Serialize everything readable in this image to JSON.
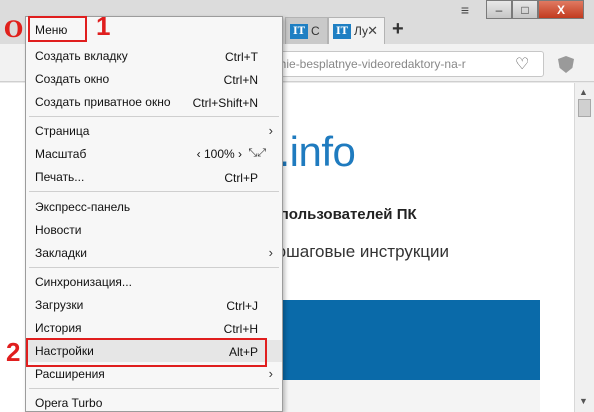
{
  "tabs": [
    {
      "label": "С",
      "favicon": "IT"
    },
    {
      "label": "Лу",
      "favicon": "IT"
    }
  ],
  "url": "chshie-besplatnye-videoredaktory-na-r",
  "window_controls": {
    "minimize": "–",
    "maximize": "□",
    "close": "X",
    "menu_glyph": "≡"
  },
  "page": {
    "logo": "c.info",
    "tagline": "их пользователей ПК",
    "description": ", пошаговые инструкции"
  },
  "menu": {
    "title": "Меню",
    "items": [
      {
        "label": "Создать вкладку",
        "shortcut": "Ctrl+T"
      },
      {
        "label": "Создать окно",
        "shortcut": "Ctrl+N"
      },
      {
        "label": "Создать приватное окно",
        "shortcut": "Ctrl+Shift+N"
      },
      {
        "label": "Страница",
        "shortcut": ""
      },
      {
        "label": "Масштаб",
        "shortcut": "",
        "zoom": "‹ 100% ›"
      },
      {
        "label": "Печать...",
        "shortcut": "Ctrl+P"
      },
      {
        "label": "Экспресс-панель",
        "shortcut": ""
      },
      {
        "label": "Новости",
        "shortcut": ""
      },
      {
        "label": "Закладки",
        "shortcut": ""
      },
      {
        "label": "Синхронизация...",
        "shortcut": ""
      },
      {
        "label": "Загрузки",
        "shortcut": "Ctrl+J"
      },
      {
        "label": "История",
        "shortcut": "Ctrl+H"
      },
      {
        "label": "Настройки",
        "shortcut": "Alt+P"
      },
      {
        "label": "Расширения",
        "shortcut": ""
      },
      {
        "label": "Opera Turbo",
        "shortcut": ""
      }
    ]
  },
  "annotations": {
    "step1": "1",
    "step2": "2"
  },
  "colors": {
    "annotation_red": "#e01e1e",
    "opera_red": "#e0201c",
    "site_blue": "#1f7bbf",
    "band_blue": "#0a6aa9"
  }
}
